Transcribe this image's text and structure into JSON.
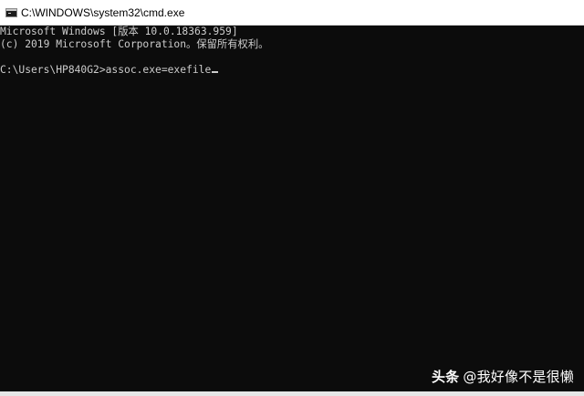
{
  "window": {
    "title": "C:\\WINDOWS\\system32\\cmd.exe",
    "icon": "cmd-console-icon"
  },
  "console": {
    "lines": [
      "Microsoft Windows [版本 10.0.18363.959]",
      "(c) 2019 Microsoft Corporation。保留所有权利。",
      "",
      "C:\\Users\\HP840G2>assoc.exe=exefile"
    ],
    "cursor": "_"
  },
  "watermark": {
    "brand": "头条",
    "handle": "@我好像不是很懒"
  },
  "colors": {
    "console_background": "#0c0c0c",
    "console_text": "#cccccc",
    "titlebar_background": "#ffffff"
  }
}
